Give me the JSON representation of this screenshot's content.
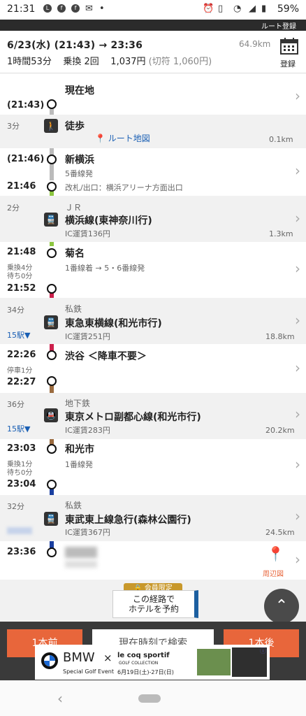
{
  "status": {
    "time": "21:31",
    "battery": "59%"
  },
  "header": {
    "register_label": "ルート登録"
  },
  "summary": {
    "line1": "6/23(水)  (21:43) → 23:36",
    "distance": "64.9km",
    "duration": "1時間53分",
    "transfers": "乗換 2回",
    "fare": "1,037円",
    "fare_ticket": "(切符 1,060円)",
    "save_label": "登録"
  },
  "route": {
    "start_name": "現在地",
    "start_time": "(21:43)",
    "walk_duration": "3分",
    "walk_mode": "徒歩",
    "walk_map": "ルート地図",
    "walk_dist": "0.1km",
    "st1_arr": "(21:46)",
    "st1_name": "新横浜",
    "st1_platform": "5番線発",
    "st1_dep": "21:46",
    "st1_exit": "改札/出口：横浜アリーナ方面出口",
    "seg1_duration": "2分",
    "seg1_company": "ＪＲ",
    "seg1_line": "横浜線(東神奈川行)",
    "seg1_fare": "IC運賃136円",
    "seg1_dist": "1.3km",
    "st2_arr": "21:48",
    "st2_name": "菊名",
    "st2_wait": "乗換4分",
    "st2_wait2": "待ち0分",
    "st2_platform": "1番線着 → 5・6番線発",
    "st2_dep": "21:52",
    "seg2_duration": "34分",
    "seg2_company": "私鉄",
    "seg2_line": "東急東横線(和光市行)",
    "seg2_fare": "IC運賃251円",
    "seg2_dist": "18.8km",
    "seg2_stops": "15駅▼",
    "st3_arr": "22:26",
    "st3_name": "渋谷 ＜降車不要＞",
    "st3_stop": "停車1分",
    "st3_dep": "22:27",
    "seg3_duration": "36分",
    "seg3_company": "地下鉄",
    "seg3_line": "東京メトロ副都心線(和光市行)",
    "seg3_fare": "IC運賃283円",
    "seg3_dist": "20.2km",
    "seg3_stops": "15駅▼",
    "st4_arr": "23:03",
    "st4_name": "和光市",
    "st4_wait": "乗換1分",
    "st4_wait2": "待ち0分",
    "st4_platform": "1番線発",
    "st4_dep": "23:04",
    "seg4_duration": "32分",
    "seg4_company": "私鉄",
    "seg4_line": "東武東上線急行(森林公園行)",
    "seg4_fare": "IC運賃367円",
    "seg4_dist": "24.5km",
    "end_time": "23:36",
    "area_map": "周辺図"
  },
  "footer": {
    "members_tag": "会員限定",
    "hotel_line1": "この経路で",
    "hotel_line2": "ホテルを予約",
    "prev": "1本前",
    "now": "現在時刻で検索",
    "next": "1本後"
  },
  "ad": {
    "brand": "BMW",
    "partner": "le coq sportif",
    "subtitle": "Special Golf Event",
    "dates": "6月19日(土)-27日(日)",
    "collection": "GOLF COLLECTION"
  },
  "colors": {
    "jr": "#8cc63f",
    "tokyu": "#cc1f4b",
    "metro": "#9b6b3f",
    "tobu": "#1a3fa0",
    "walk": "#bbbbbb",
    "accent": "#e8663b"
  }
}
